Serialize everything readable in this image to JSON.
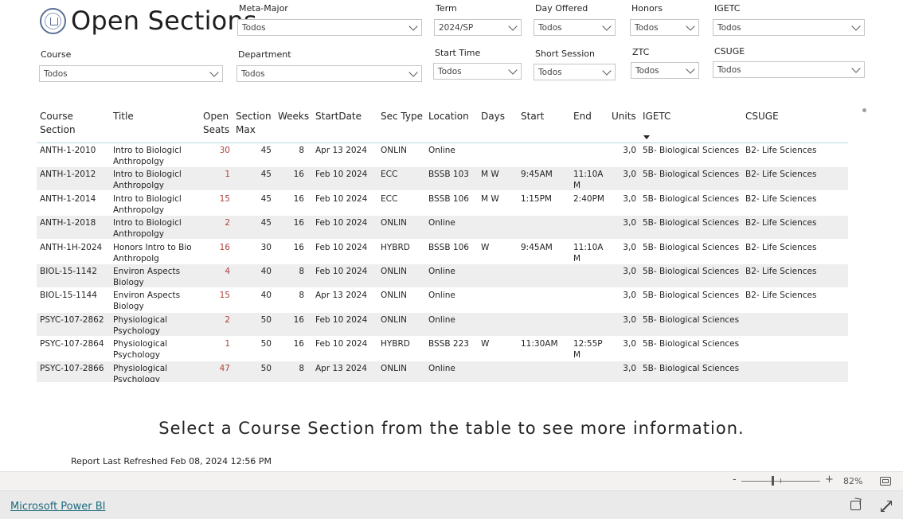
{
  "header": {
    "title": "Open Sections"
  },
  "slicers": {
    "meta_major": {
      "label": "Meta-Major",
      "value": "Todos"
    },
    "term": {
      "label": "Term",
      "value": "2024/SP"
    },
    "day_offered": {
      "label": "Day Offered",
      "value": "Todos"
    },
    "honors": {
      "label": "Honors",
      "value": "Todos"
    },
    "igetc": {
      "label": "IGETC",
      "value": "Todos"
    },
    "course": {
      "label": "Course",
      "value": "Todos"
    },
    "department": {
      "label": "Department",
      "value": "Todos"
    },
    "start_time": {
      "label": "Start Time",
      "value": "Todos"
    },
    "short_session": {
      "label": "Short Session",
      "value": "Todos"
    },
    "ztc": {
      "label": "ZTC",
      "value": "Todos"
    },
    "csuge": {
      "label": "CSUGE",
      "value": "Todos"
    }
  },
  "table": {
    "columns": {
      "course_section": "Course\nSection",
      "title": "Title",
      "open_seats": "Open\nSeats",
      "section_max": "Section\nMax",
      "weeks": "Weeks",
      "start_date": "StartDate",
      "sec_type": "Sec Type",
      "location": "Location",
      "days": "Days",
      "start": "Start",
      "end": "End",
      "units": "Units",
      "igetc": "IGETC",
      "csuge": "CSUGE"
    },
    "rows": [
      {
        "course_section": "ANTH-1-2010",
        "title": "Intro to Biologicl\nAnthropolgy",
        "open_seats": "30",
        "section_max": "45",
        "weeks": "8",
        "start_date": "Apr 13 2024",
        "sec_type": "ONLIN",
        "location": "Online",
        "days": "",
        "start": "",
        "end": "",
        "units": "3,0",
        "igetc": "5B- Biological Sciences",
        "csuge": "B2- Life Sciences"
      },
      {
        "course_section": "ANTH-1-2012",
        "title": "Intro to Biologicl\nAnthropolgy",
        "open_seats": "1",
        "section_max": "45",
        "weeks": "16",
        "start_date": "Feb 10 2024",
        "sec_type": "ECC",
        "location": "BSSB 103",
        "days": "M W",
        "start": "9:45AM",
        "end": "11:10A\nM",
        "units": "3,0",
        "igetc": "5B- Biological Sciences",
        "csuge": "B2- Life Sciences"
      },
      {
        "course_section": "ANTH-1-2014",
        "title": "Intro to Biologicl\nAnthropolgy",
        "open_seats": "15",
        "section_max": "45",
        "weeks": "16",
        "start_date": "Feb 10 2024",
        "sec_type": "ECC",
        "location": "BSSB 106",
        "days": "M W",
        "start": "1:15PM",
        "end": "2:40PM",
        "units": "3,0",
        "igetc": "5B- Biological Sciences",
        "csuge": "B2- Life Sciences"
      },
      {
        "course_section": "ANTH-1-2018",
        "title": "Intro to Biologicl\nAnthropolgy",
        "open_seats": "2",
        "section_max": "45",
        "weeks": "16",
        "start_date": "Feb 10 2024",
        "sec_type": "ONLIN",
        "location": "Online",
        "days": "",
        "start": "",
        "end": "",
        "units": "3,0",
        "igetc": "5B- Biological Sciences",
        "csuge": "B2- Life Sciences"
      },
      {
        "course_section": "ANTH-1H-2024",
        "title": "Honors Intro to Bio\nAnthropolg",
        "open_seats": "16",
        "section_max": "30",
        "weeks": "16",
        "start_date": "Feb 10 2024",
        "sec_type": "HYBRD",
        "location": "BSSB 106",
        "days": "W",
        "start": "9:45AM",
        "end": "11:10A\nM",
        "units": "3,0",
        "igetc": "5B- Biological Sciences",
        "csuge": "B2- Life Sciences"
      },
      {
        "course_section": "BIOL-15-1142",
        "title": "Environ Aspects\nBiology",
        "open_seats": "4",
        "section_max": "40",
        "weeks": "8",
        "start_date": "Feb 10 2024",
        "sec_type": "ONLIN",
        "location": "Online",
        "days": "",
        "start": "",
        "end": "",
        "units": "3,0",
        "igetc": "5B- Biological Sciences",
        "csuge": "B2- Life Sciences"
      },
      {
        "course_section": "BIOL-15-1144",
        "title": "Environ Aspects\nBiology",
        "open_seats": "15",
        "section_max": "40",
        "weeks": "8",
        "start_date": "Apr 13 2024",
        "sec_type": "ONLIN",
        "location": "Online",
        "days": "",
        "start": "",
        "end": "",
        "units": "3,0",
        "igetc": "5B- Biological Sciences",
        "csuge": "B2- Life Sciences"
      },
      {
        "course_section": "PSYC-107-2862",
        "title": "Physiological\nPsychology",
        "open_seats": "2",
        "section_max": "50",
        "weeks": "16",
        "start_date": "Feb 10 2024",
        "sec_type": "ONLIN",
        "location": "Online",
        "days": "",
        "start": "",
        "end": "",
        "units": "3,0",
        "igetc": "5B- Biological Sciences",
        "csuge": ""
      },
      {
        "course_section": "PSYC-107-2864",
        "title": "Physiological\nPsychology",
        "open_seats": "1",
        "section_max": "50",
        "weeks": "16",
        "start_date": "Feb 10 2024",
        "sec_type": "HYBRD",
        "location": "BSSB 223",
        "days": "W",
        "start": "11:30AM",
        "end": "12:55P\nM",
        "units": "3,0",
        "igetc": "5B- Biological Sciences",
        "csuge": ""
      },
      {
        "course_section": "PSYC-107-2866",
        "title": "Physiological\nPsychology",
        "open_seats": "47",
        "section_max": "50",
        "weeks": "8",
        "start_date": "Apr 13 2024",
        "sec_type": "ONLIN",
        "location": "Online",
        "days": "",
        "start": "",
        "end": "",
        "units": "3,0",
        "igetc": "5B- Biological Sciences",
        "csuge": ""
      }
    ]
  },
  "messages": {
    "select_prompt": "Select a Course Section from the table to see more information.",
    "last_refreshed": "Report Last Refreshed Feb 08, 2024 12:56 PM"
  },
  "zoom": {
    "minus": "-",
    "plus": "+",
    "level": "82%"
  },
  "footer": {
    "powerbi_link": "Microsoft Power BI"
  },
  "colors": {
    "seats_text": "#b1403c",
    "header_underline": "#b7d6dc",
    "link": "#1d6b7d"
  },
  "icons": [
    "college-seal-icon",
    "chevron-down-icon",
    "sort-descending-icon",
    "fit-to-page-icon",
    "share-icon",
    "fullscreen-icon"
  ]
}
